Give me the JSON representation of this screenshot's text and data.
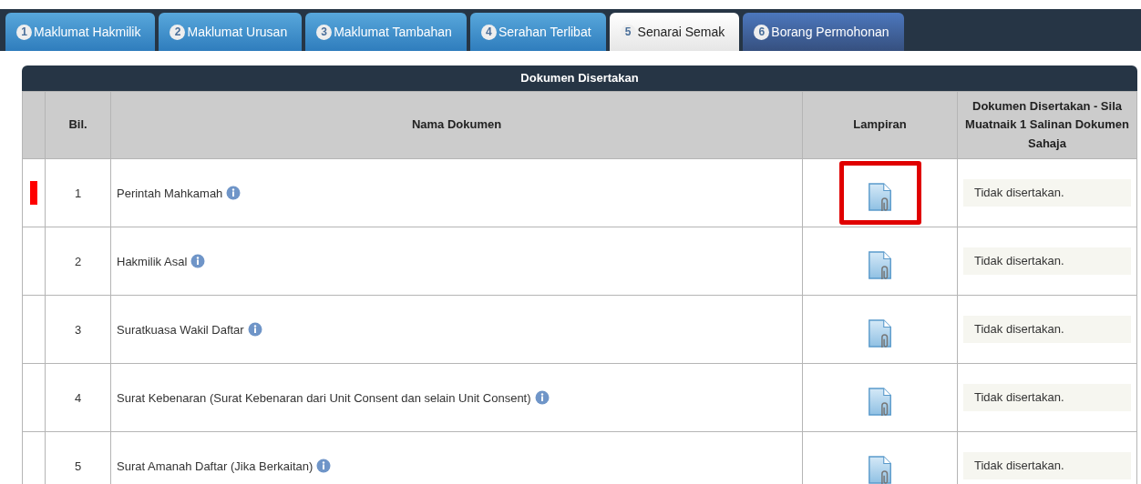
{
  "tabs": [
    {
      "number": "1",
      "label": "Maklumat Hakmilik",
      "kind": "step",
      "selected": false
    },
    {
      "number": "2",
      "label": "Maklumat Urusan",
      "kind": "step",
      "selected": false
    },
    {
      "number": "3",
      "label": "Maklumat Tambahan",
      "kind": "step",
      "selected": false
    },
    {
      "number": "4",
      "label": "Serahan Terlibat",
      "kind": "step",
      "selected": false
    },
    {
      "number": "5",
      "label": "Senarai Semak",
      "kind": "step",
      "selected": true
    },
    {
      "number": "6",
      "label": "Borang Permohonan",
      "kind": "final",
      "selected": false
    }
  ],
  "table": {
    "title": "Dokumen Disertakan",
    "columns": [
      "Bil.",
      "Nama Dokumen",
      "Lampiran",
      "Dokumen Disertakan - Sila Muatnaik 1 Salinan Dokumen Sahaja"
    ],
    "rows": [
      {
        "number": "1",
        "name": "Perintah Mahkamah",
        "status": "Tidak disertakan.",
        "marked": true,
        "highlighted": true
      },
      {
        "number": "2",
        "name": "Hakmilik Asal",
        "status": "Tidak disertakan.",
        "marked": false,
        "highlighted": false
      },
      {
        "number": "3",
        "name": "Suratkuasa Wakil Daftar",
        "status": "Tidak disertakan.",
        "marked": false,
        "highlighted": false
      },
      {
        "number": "4",
        "name": "Surat Kebenaran (Surat Kebenaran dari Unit Consent dan selain Unit Consent)",
        "status": "Tidak disertakan.",
        "marked": false,
        "highlighted": false
      },
      {
        "number": "5",
        "name": "Surat Amanah Daftar (Jika Berkaitan)",
        "status": "Tidak disertakan.",
        "marked": false,
        "highlighted": false
      }
    ]
  }
}
